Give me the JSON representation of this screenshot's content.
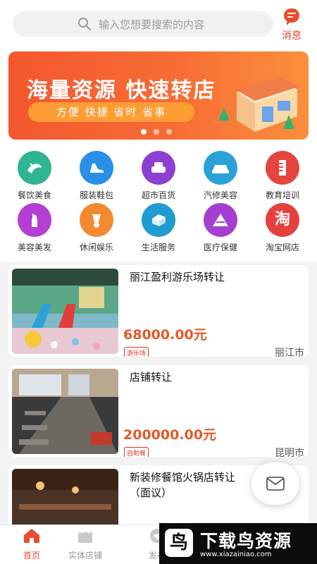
{
  "search": {
    "placeholder": "输入您想要搜索的内容"
  },
  "header": {
    "message_label": "消息"
  },
  "banner": {
    "title": "海量资源 快速转店",
    "subtitle": "方便 快捷 省时 省事"
  },
  "categories": [
    {
      "label": "餐饮美食",
      "icon": "food-icon",
      "color": "#2fb592"
    },
    {
      "label": "服装鞋包",
      "icon": "shoe-icon",
      "color": "#2a8fe8"
    },
    {
      "label": "超市百货",
      "icon": "sofa-icon",
      "color": "#8e3fd1"
    },
    {
      "label": "汽修美容",
      "icon": "car-icon",
      "color": "#2aa2d8"
    },
    {
      "label": "教育培训",
      "icon": "ruler-icon",
      "color": "#e5453f"
    },
    {
      "label": "美容美发",
      "icon": "lipstick-icon",
      "color": "#b53ed4"
    },
    {
      "label": "休闲娱乐",
      "icon": "badminton-icon",
      "color": "#f48a30"
    },
    {
      "label": "生活服务",
      "icon": "service-icon",
      "color": "#1f9bd1"
    },
    {
      "label": "医疗保健",
      "icon": "medical-icon",
      "color": "#a53fd0"
    },
    {
      "label": "淘宝网店",
      "icon": "taobao-icon",
      "color": "#e4413e"
    }
  ],
  "listings": [
    {
      "title": "丽江盈利游乐场转让",
      "price": "68000.00元",
      "tag": "游乐场",
      "city": "丽江市"
    },
    {
      "title": "店铺转让",
      "price": "200000.00元",
      "tag": "自助餐",
      "city": "昆明市"
    },
    {
      "title": "新装修餐馆火锅店转让（面议）",
      "price": "",
      "tag": "",
      "city": ""
    }
  ],
  "tabs": [
    {
      "label": "首页",
      "active": true
    },
    {
      "label": "实体店铺",
      "active": false
    },
    {
      "label": "发布",
      "active": false
    }
  ],
  "watermark": {
    "logo": "鸟",
    "text": "下载鸟资源",
    "url": "www.xiazainiao.com"
  },
  "colors": {
    "accent": "#e84d2f",
    "price": "#e35a29",
    "active_tab": "#e84d2f"
  }
}
